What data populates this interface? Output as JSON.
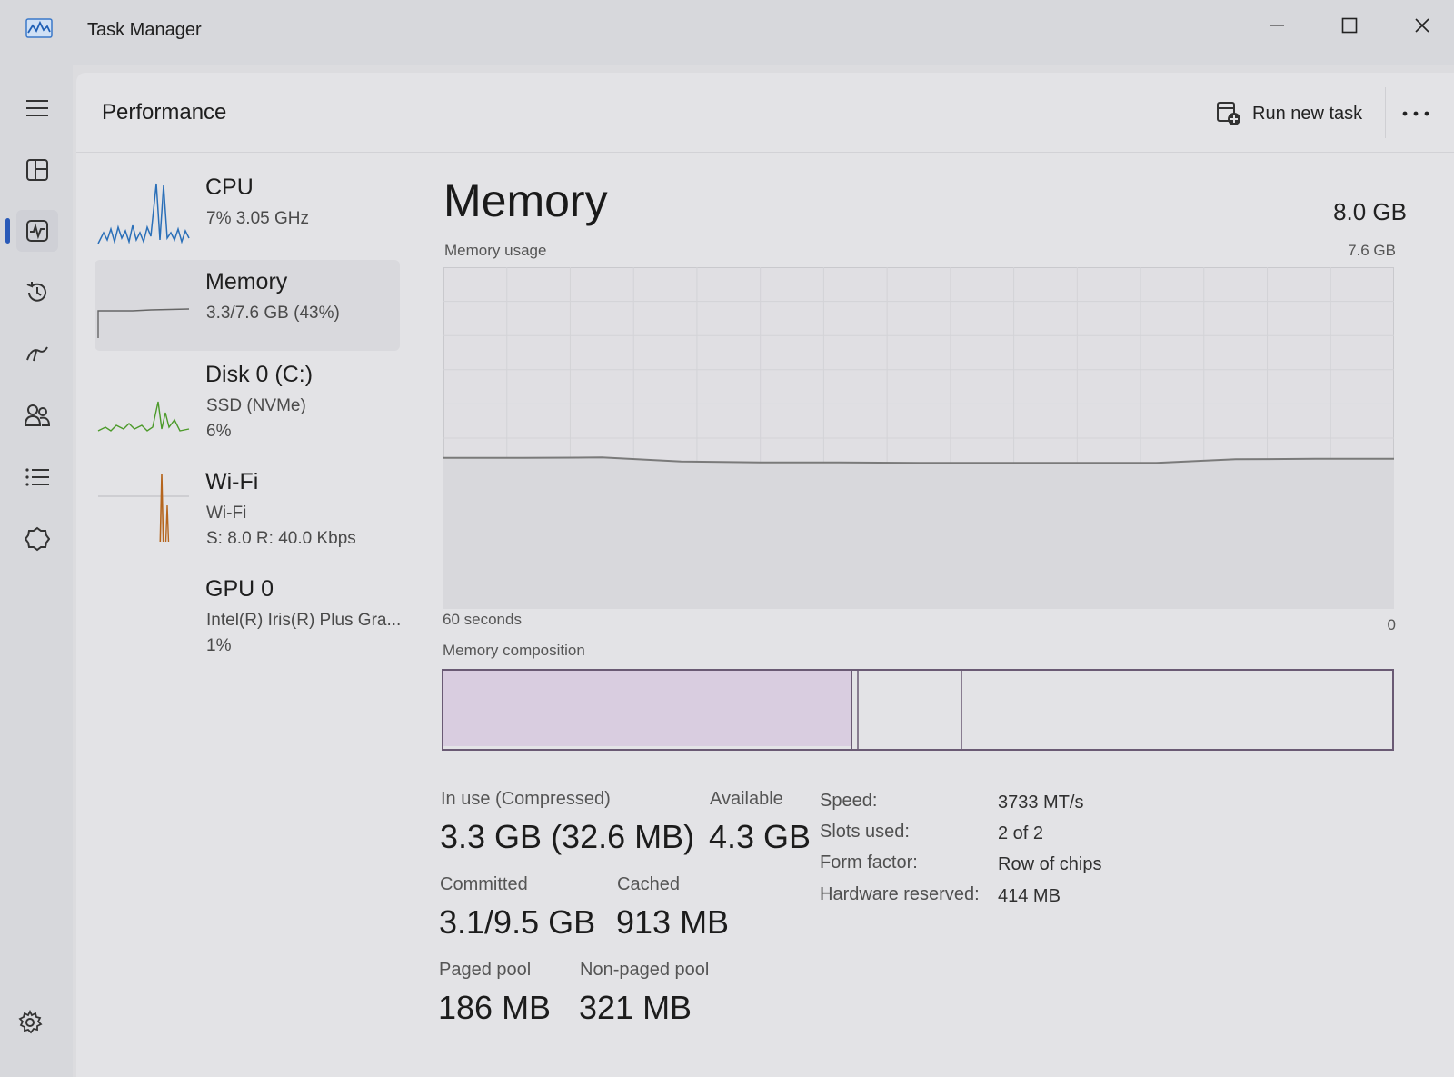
{
  "window": {
    "title": "Task Manager",
    "minimize_icon": "minimize-icon",
    "maximize_icon": "maximize-icon",
    "close_icon": "close-icon"
  },
  "nav": {
    "items": [
      {
        "name": "menu-icon"
      },
      {
        "name": "processes-icon"
      },
      {
        "name": "performance-icon",
        "active": true
      },
      {
        "name": "app-history-icon"
      },
      {
        "name": "startup-apps-icon"
      },
      {
        "name": "users-icon"
      },
      {
        "name": "details-icon"
      },
      {
        "name": "services-icon"
      }
    ],
    "settings_icon": "settings-icon"
  },
  "header": {
    "title": "Performance",
    "run_new_task": "Run new task",
    "more": "..."
  },
  "devices": [
    {
      "name": "CPU",
      "sub1": "7%  3.05 GHz",
      "sub2": "",
      "color": "#2a6fb8"
    },
    {
      "name": "Memory",
      "sub1": "3.3/7.6 GB (43%)",
      "sub2": "",
      "color": "#555555",
      "selected": true
    },
    {
      "name": "Disk 0 (C:)",
      "sub1": "SSD (NVMe)",
      "sub2": "6%",
      "color": "#4c9a2a"
    },
    {
      "name": "Wi-Fi",
      "sub1": "Wi-Fi",
      "sub2": "S: 8.0  R: 40.0 Kbps",
      "color": "#b5651d"
    },
    {
      "name": "GPU 0",
      "sub1": "Intel(R) Iris(R) Plus Gra...",
      "sub2": "1%",
      "color": "#2a6fb8"
    }
  ],
  "detail": {
    "title": "Memory",
    "total": "8.0 GB",
    "usage_label": "Memory usage",
    "usage_max": "7.6 GB",
    "time_label": "60 seconds",
    "zero_label": "0",
    "composition_label": "Memory composition",
    "line_color": "#7a7a7a",
    "composition_fill": "#d9cde0"
  },
  "stats": {
    "in_use_label": "In use (Compressed)",
    "in_use_value": "3.3 GB (32.6 MB)",
    "available_label": "Available",
    "available_value": "4.3 GB",
    "committed_label": "Committed",
    "committed_value": "3.1/9.5 GB",
    "cached_label": "Cached",
    "cached_value": "913 MB",
    "paged_label": "Paged pool",
    "paged_value": "186 MB",
    "nonpaged_label": "Non-paged pool",
    "nonpaged_value": "321 MB"
  },
  "properties": [
    {
      "label": "Speed:",
      "value": "3733 MT/s"
    },
    {
      "label": "Slots used:",
      "value": "2 of 2"
    },
    {
      "label": "Form factor:",
      "value": "Row of chips"
    },
    {
      "label": "Hardware reserved:",
      "value": "414 MB"
    }
  ],
  "chart_data": {
    "type": "area",
    "x": [
      60,
      55,
      50,
      45,
      40,
      35,
      30,
      25,
      20,
      15,
      10,
      5,
      0
    ],
    "values": [
      3.36,
      3.36,
      3.37,
      3.28,
      3.26,
      3.26,
      3.25,
      3.25,
      3.25,
      3.25,
      3.33,
      3.34,
      3.34
    ],
    "xlabel": "60 seconds",
    "ylabel": "Memory usage",
    "ylim": [
      0,
      7.6
    ],
    "grid": true
  }
}
